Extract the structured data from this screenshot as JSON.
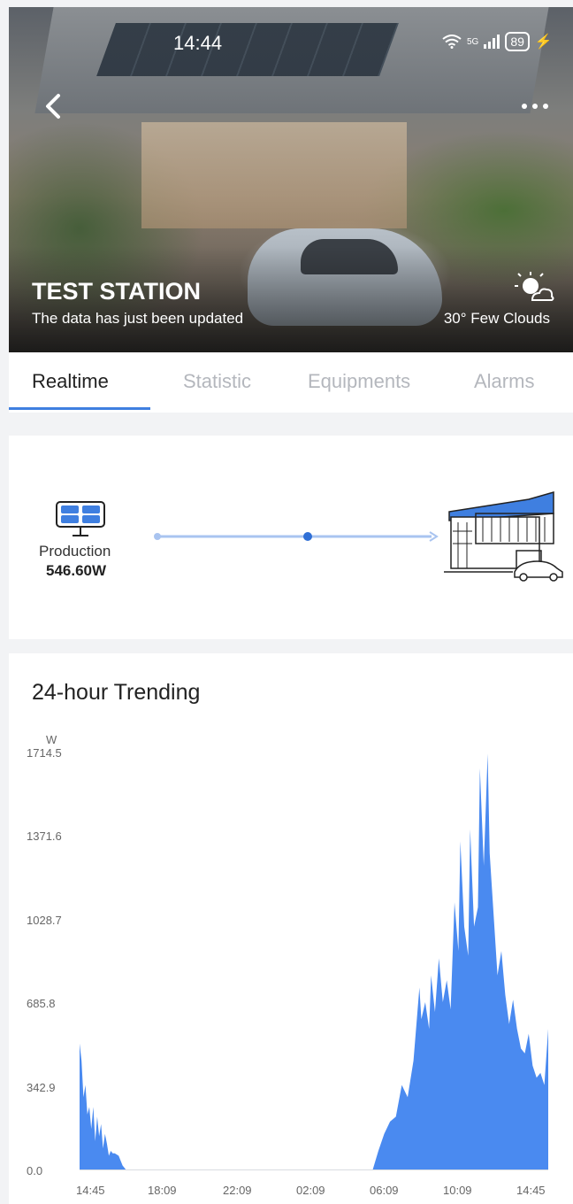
{
  "status_bar": {
    "time": "14:44",
    "network": "5G",
    "battery": "89"
  },
  "hero": {
    "station_name": "TEST STATION",
    "update_text": "The data has just been updated",
    "weather": "30° Few Clouds"
  },
  "tabs": [
    {
      "label": "Realtime",
      "active": true
    },
    {
      "label": "Statistic",
      "active": false
    },
    {
      "label": "Equipments",
      "active": false
    },
    {
      "label": "Alarms",
      "active": false
    }
  ],
  "flow": {
    "production_label": "Production",
    "production_value": "546.60W"
  },
  "trend": {
    "title": "24-hour Trending"
  },
  "colors": {
    "accent": "#3f7fe0",
    "area_fill": "#4a8af0"
  },
  "chart_data": {
    "type": "area",
    "title": "24-hour Trending",
    "ylabel": "W",
    "ylim": [
      0,
      1714.5
    ],
    "yticks": [
      "0.0",
      "342.9",
      "685.8",
      "1028.7",
      "1371.6",
      "1714.5"
    ],
    "xticks": [
      "14:45",
      "18:09",
      "22:09",
      "02:09",
      "06:09",
      "10:09",
      "14:45"
    ],
    "x_range": [
      0,
      24
    ],
    "series": [
      {
        "x": [
          0,
          0.1,
          0.2,
          0.3,
          0.4,
          0.5,
          0.6,
          0.7,
          0.8,
          0.9,
          1.0,
          1.1,
          1.2,
          1.3,
          1.4,
          1.5,
          1.6,
          1.7,
          1.8,
          2.0,
          2.2,
          2.4,
          2.6,
          3.0,
          6.0,
          12.0,
          15.0,
          15.3,
          15.6,
          15.9,
          16.2,
          16.5,
          16.8,
          17.1,
          17.4,
          17.5,
          17.7,
          17.9,
          18.0,
          18.2,
          18.4,
          18.6,
          18.8,
          19.0,
          19.2,
          19.4,
          19.5,
          19.7,
          19.9,
          20.0,
          20.2,
          20.4,
          20.5,
          20.7,
          20.9,
          21.0,
          21.2,
          21.4,
          21.6,
          21.8,
          22.0,
          22.2,
          22.4,
          22.6,
          22.8,
          23.0,
          23.2,
          23.4,
          23.6,
          23.8,
          24.0
        ],
        "values": [
          520,
          450,
          300,
          350,
          230,
          260,
          170,
          260,
          120,
          220,
          140,
          190,
          90,
          150,
          110,
          60,
          80,
          70,
          70,
          60,
          20,
          0,
          0,
          0,
          0,
          0,
          0,
          80,
          150,
          200,
          220,
          350,
          300,
          450,
          750,
          620,
          690,
          580,
          800,
          650,
          870,
          690,
          780,
          660,
          1100,
          900,
          1350,
          1000,
          880,
          1400,
          1000,
          1080,
          1650,
          1250,
          1710,
          1300,
          1050,
          800,
          900,
          720,
          600,
          700,
          580,
          500,
          480,
          560,
          430,
          380,
          400,
          350,
          580
        ]
      }
    ],
    "grid": false,
    "legend": "none"
  }
}
